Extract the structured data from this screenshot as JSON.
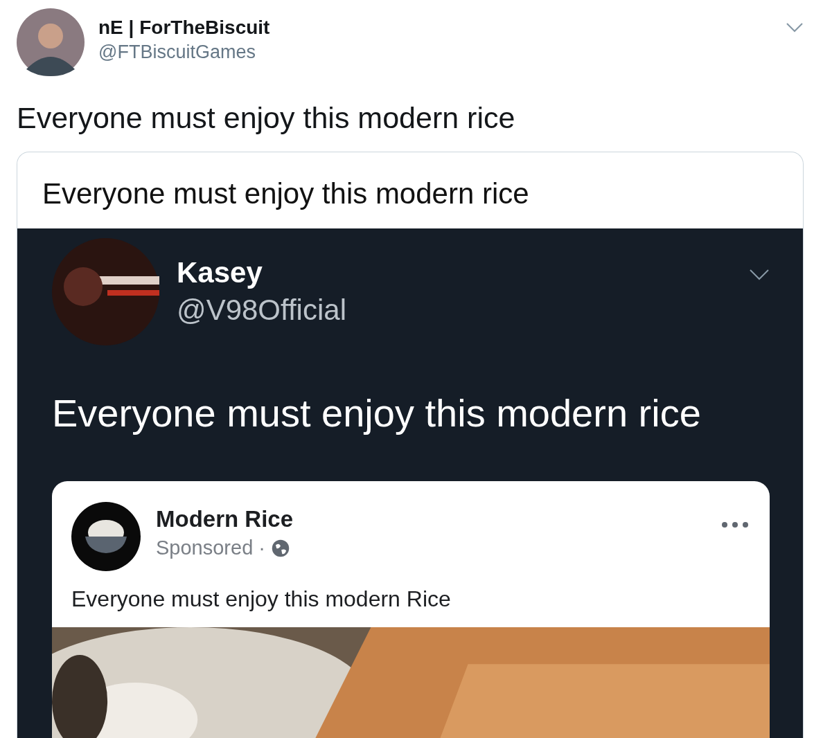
{
  "tweet": {
    "author": {
      "name": "nE | ForTheBiscuit",
      "handle": "@FTBiscuitGames"
    },
    "text": "Everyone must enjoy this modern rice",
    "card": {
      "title": "Everyone must enjoy this modern rice",
      "screenshot": {
        "author": {
          "name": "Kasey",
          "handle": "@V98Official"
        },
        "text": "Everyone must enjoy this modern rice",
        "post": {
          "page_name": "Modern Rice",
          "label": "Sponsored",
          "separator": "·",
          "text": "Everyone must enjoy this modern Rice"
        }
      }
    }
  }
}
